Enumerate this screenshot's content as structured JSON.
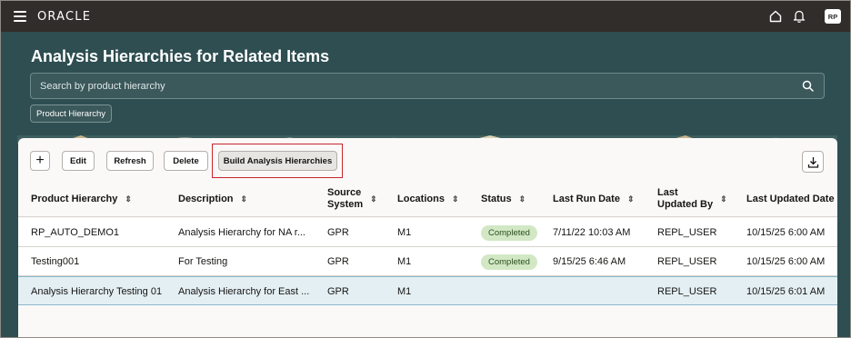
{
  "topbar": {
    "brand": "ORACLE",
    "avatar_initials": "RP",
    "icons": [
      "hamburger-menu-icon",
      "home-icon",
      "notification-bell-icon"
    ]
  },
  "page": {
    "title": "Analysis Hierarchies for Related Items",
    "search_placeholder": "Search by product hierarchy",
    "filter_chip": "Product Hierarchy"
  },
  "toolbar": {
    "add_label": "+",
    "edit_label": "Edit",
    "refresh_label": "Refresh",
    "delete_label": "Delete",
    "build_label": "Build Analysis Hierarchies"
  },
  "table": {
    "columns": [
      {
        "line1": "Product Hierarchy",
        "line2": ""
      },
      {
        "line1": "Description",
        "line2": ""
      },
      {
        "line1": "Source",
        "line2": "System"
      },
      {
        "line1": "Locations",
        "line2": ""
      },
      {
        "line1": "Status",
        "line2": ""
      },
      {
        "line1": "Last Run Date",
        "line2": ""
      },
      {
        "line1": "Last",
        "line2": "Updated By"
      },
      {
        "line1": "Last Updated Date",
        "line2": ""
      }
    ],
    "rows": [
      {
        "hierarchy": "RP_AUTO_DEMO1",
        "description": "Analysis Hierarchy for NA r...",
        "source": "GPR",
        "locations": "M1",
        "status": "Completed",
        "last_run": "7/11/22 10:03 AM",
        "updated_by": "REPL_USER",
        "updated_date": "10/15/25 6:00 AM"
      },
      {
        "hierarchy": "Testing001",
        "description": "For Testing",
        "source": "GPR",
        "locations": "M1",
        "status": "Completed",
        "last_run": "9/15/25 6:46 AM",
        "updated_by": "REPL_USER",
        "updated_date": "10/15/25 6:00 AM"
      },
      {
        "hierarchy": "Analysis Hierarchy Testing 01",
        "description": "Analysis Hierarchy for East ...",
        "source": "GPR",
        "locations": "M1",
        "status": "",
        "last_run": "",
        "updated_by": "REPL_USER",
        "updated_date": "10/15/25 6:01 AM"
      }
    ]
  },
  "colors": {
    "topbar": "#312d2a",
    "hero": "#2e4e51",
    "status_completed_bg": "#d2e8c5",
    "selected_row": "#e4eff4",
    "highlight_border": "#c7252e"
  }
}
